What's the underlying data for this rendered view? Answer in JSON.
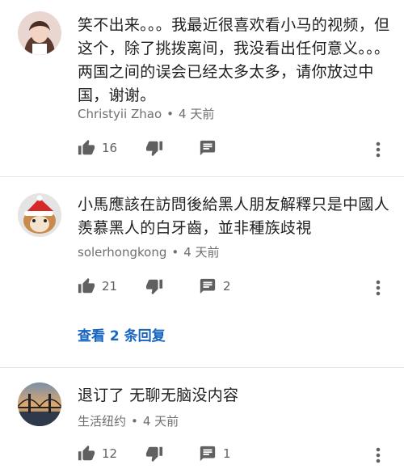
{
  "comments": [
    {
      "text": "笑不出来。。。我最近很喜欢看小马的视频，但这个，除了挑拨离间，我没看出任何意义。。。两国之间的误会已经太多太多，请你放过中国，谢谢。",
      "author": "Christyii Zhao",
      "time": "4 天前",
      "likes": "16",
      "replies_count": ""
    },
    {
      "text": "小馬應該在訪問後給黑人朋友解釋只是中國人羨慕黑人的白牙齒，並非種族歧視",
      "author": "solerhongkong",
      "time": "4 天前",
      "likes": "21",
      "replies_count": "2",
      "view_replies": "查看 2 条回复"
    },
    {
      "text": "退订了 无聊无脑没内容",
      "author": "生活纽约",
      "time": "4 天前",
      "likes": "12",
      "replies_count": "1"
    }
  ],
  "separator": "•",
  "icons": {
    "like": "thumb-up-icon",
    "dislike": "thumb-down-icon",
    "reply": "comment-icon",
    "more": "more-vert-icon"
  },
  "colors": {
    "link": "#1565c0",
    "meta": "#6f6f6f",
    "icon": "#606060"
  }
}
